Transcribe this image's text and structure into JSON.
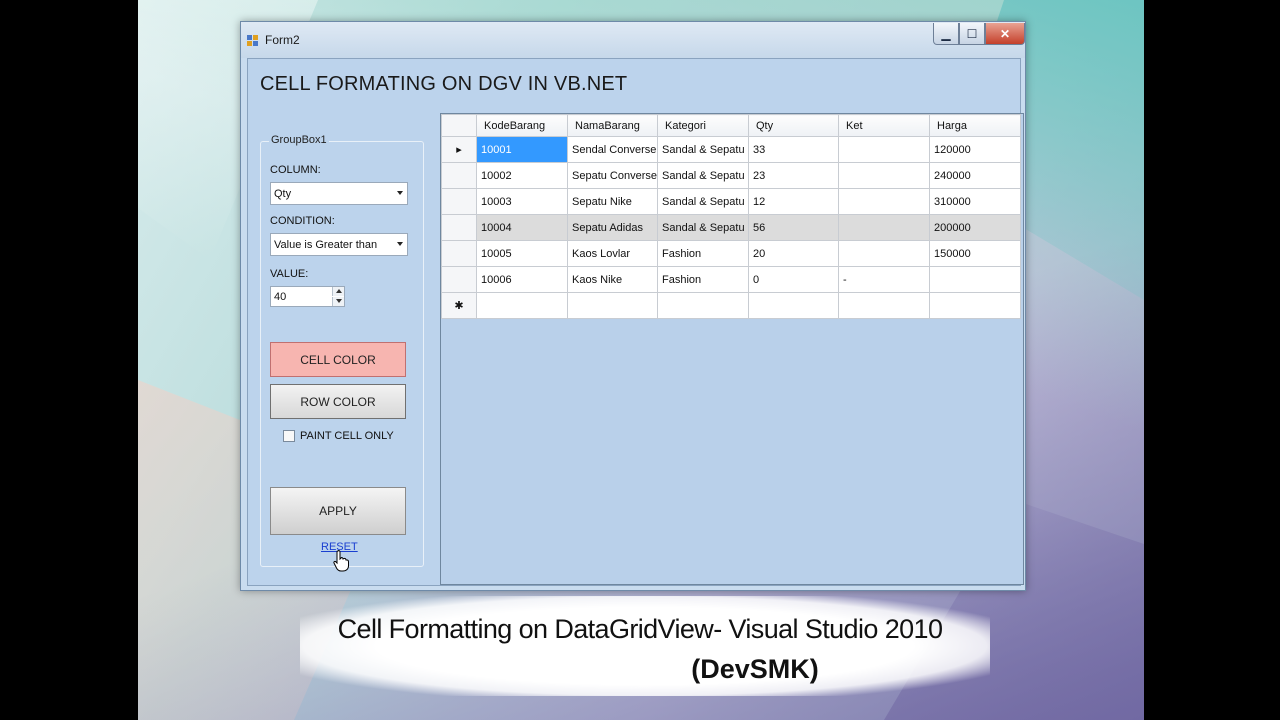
{
  "window": {
    "title": "Form2",
    "heading": "CELL FORMATING ON DGV IN VB.NET"
  },
  "groupbox": {
    "title": "GroupBox1",
    "column_label": "COLUMN:",
    "column_value": "Qty",
    "condition_label": "CONDITION:",
    "condition_value": "Value is Greater than",
    "value_label": "VALUE:",
    "value": "40",
    "cell_color_label": "CELL COLOR",
    "row_color_label": "ROW COLOR",
    "paint_cell_only_label": "PAINT CELL ONLY",
    "apply_label": "APPLY",
    "reset_label": "RESET"
  },
  "grid": {
    "columns": [
      "KodeBarang",
      "NamaBarang",
      "Kategori",
      "Qty",
      "Ket",
      "Harga"
    ],
    "rows": [
      [
        "10001",
        "Sendal Converse",
        "Sandal & Sepatu",
        "33",
        "",
        "120000"
      ],
      [
        "10002",
        "Sepatu Converse",
        "Sandal & Sepatu",
        "23",
        "",
        "240000"
      ],
      [
        "10003",
        "Sepatu Nike",
        "Sandal & Sepatu",
        "12",
        "",
        "310000"
      ],
      [
        "10004",
        "Sepatu Adidas",
        "Sandal & Sepatu",
        "56",
        "",
        "200000"
      ],
      [
        "10005",
        "Kaos Lovlar",
        "Fashion",
        "20",
        "",
        "150000"
      ],
      [
        "10006",
        "Kaos Nike",
        "Fashion",
        "0",
        "-",
        ""
      ]
    ],
    "current_row_marker": "▸",
    "new_row_marker": "✱"
  },
  "caption": {
    "line1": "Cell Formatting  on DataGridView- Visual Studio 2010",
    "line2": "(DevSMK)"
  },
  "colors": {
    "highlight_cell": "#ffb6b6",
    "selected_cell": "#3399ff",
    "highlight_row": "#dcdcdc"
  }
}
